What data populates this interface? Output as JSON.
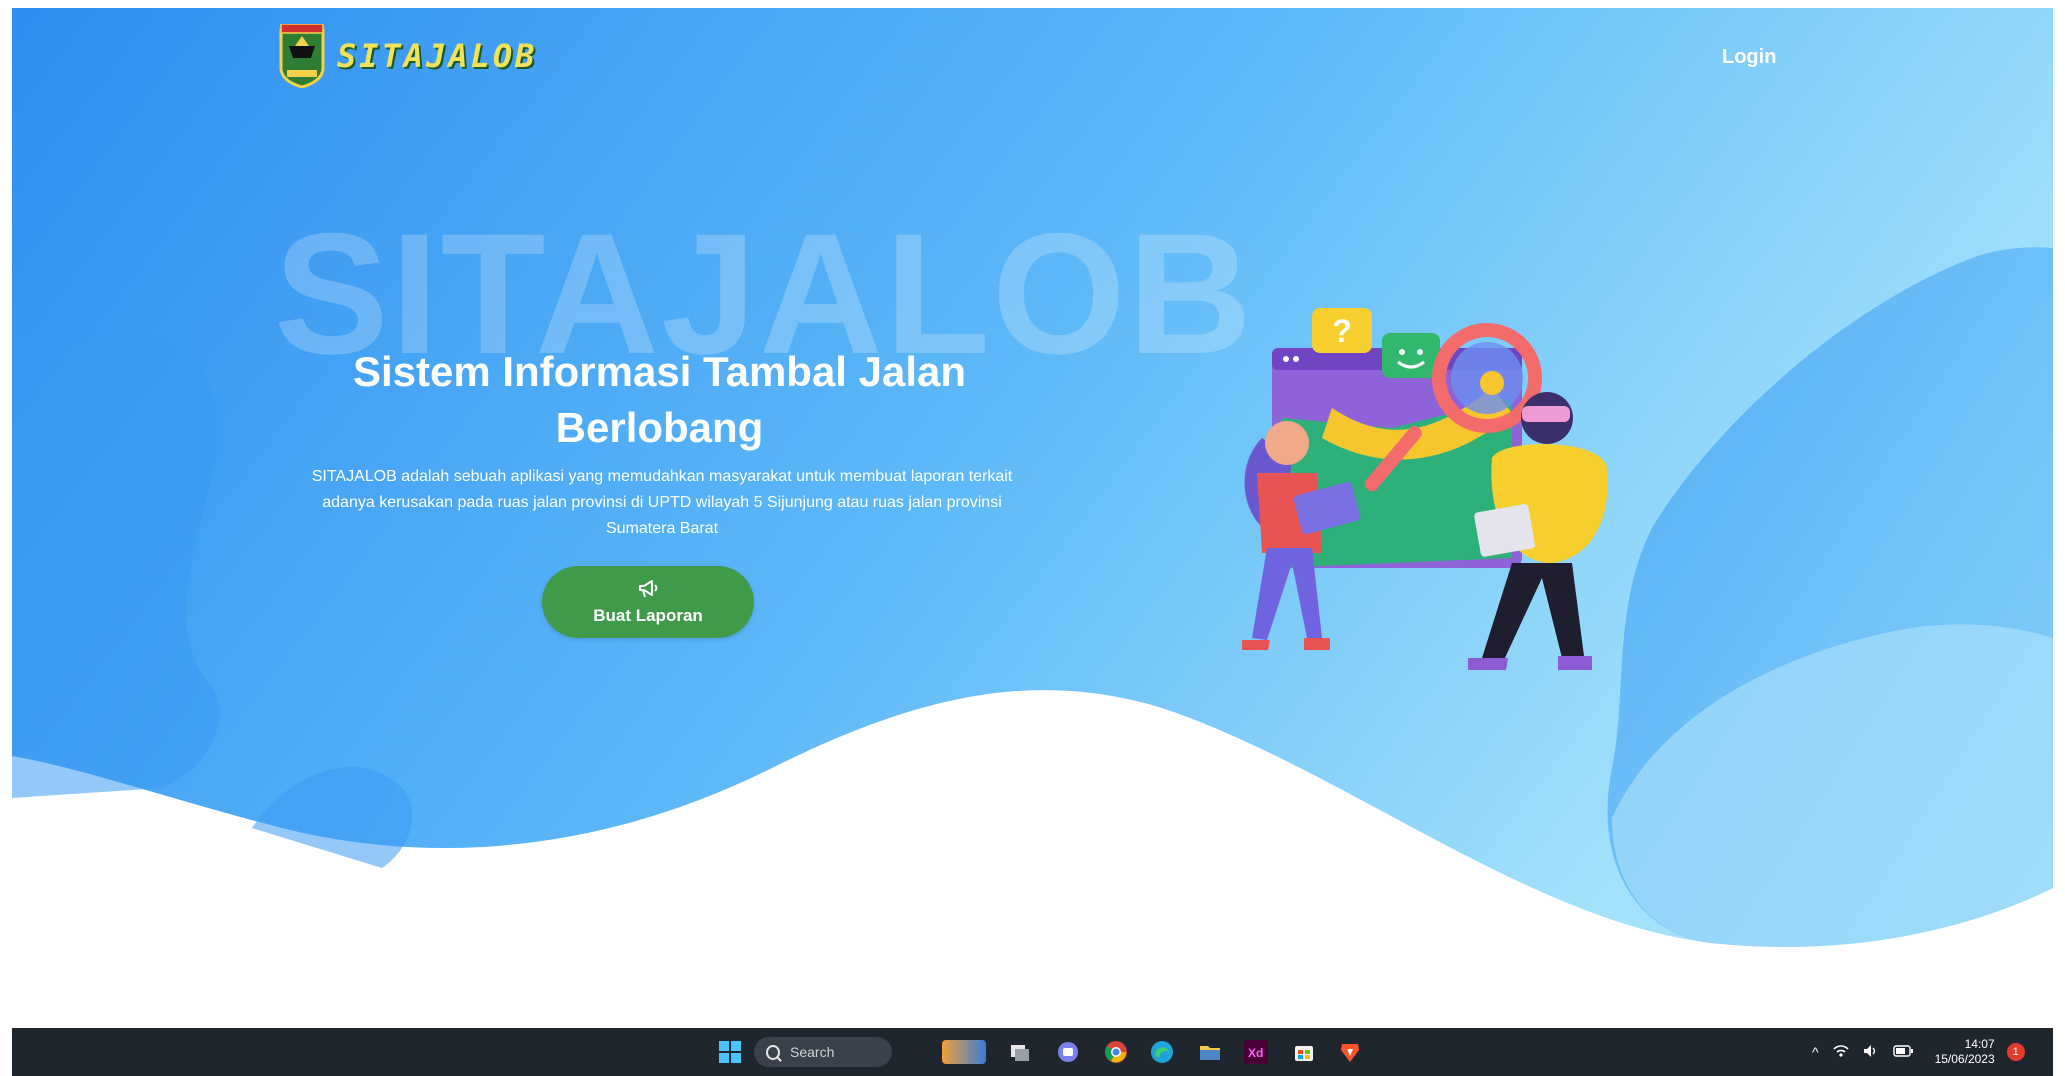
{
  "brand": {
    "name": "SITAJALOB"
  },
  "nav": {
    "login_label": "Login"
  },
  "hero": {
    "watermark": "SITAJALOB",
    "title_line1": "Sistem Informasi Tambal Jalan",
    "title_line2": "Berlobang",
    "description": "SITAJALOB adalah sebuah aplikasi yang memudahkan masyarakat untuk membuat laporan terkait adanya kerusakan pada ruas jalan provinsi di UPTD wilayah 5 Sijunjung atau ruas jalan provinsi Sumatera Barat",
    "cta_label": "Buat Laporan",
    "cta_icon": "megaphone-icon"
  },
  "colors": {
    "hero_gradient_start": "#2f8ef0",
    "hero_gradient_end": "#9fe0fb",
    "cta_button": "#3f9a4a",
    "taskbar": "#20262e"
  },
  "taskbar": {
    "search_placeholder": "Search",
    "apps": [
      "windows-start-icon",
      "search-icon",
      "widgets-icon",
      "task-view-icon",
      "teams-chat-icon",
      "chrome-icon",
      "edge-icon",
      "file-explorer-icon",
      "xd-icon",
      "store-icon",
      "brave-icon"
    ],
    "tray_chevron": "^",
    "clock_time": "14:07",
    "clock_date": "15/06/2023",
    "notification_count": "1"
  }
}
